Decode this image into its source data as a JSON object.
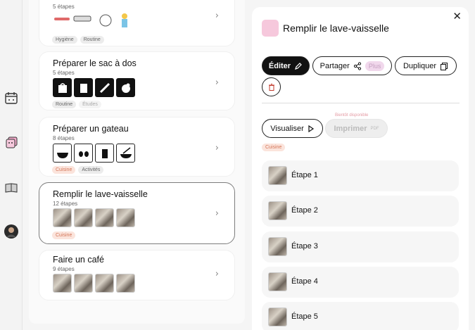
{
  "list": {
    "cards": [
      {
        "title": "",
        "steps": "5 étapes",
        "tags": [
          "Hygiène",
          "Routine"
        ]
      },
      {
        "title": "Préparer le sac à dos",
        "steps": "5 étapes",
        "tags": [
          "Routine",
          "Études"
        ]
      },
      {
        "title": "Préparer un gateau",
        "steps": "8 étapes",
        "tags": [
          "Cuisine",
          "Activités"
        ]
      },
      {
        "title": "Remplir le lave-vaisselle",
        "steps": "12 étapes",
        "tags": [
          "Cuisine"
        ]
      },
      {
        "title": "Faire un café",
        "steps": "9 étapes",
        "tags": []
      }
    ]
  },
  "detail": {
    "title": "Remplir le lave-vaisselle",
    "edit_label": "Éditer",
    "share_label": "Partager",
    "plus_badge": "Plus",
    "duplicate_label": "Dupliquer",
    "visualize_label": "Visualiser",
    "print_label": "Imprimer",
    "print_format": "PDF",
    "coming_soon": "Bientôt disponible",
    "tag": "Cuisine",
    "steps": [
      "Étape 1",
      "Étape 2",
      "Étape 3",
      "Étape 4",
      "Étape 5"
    ]
  },
  "colors": {
    "accent_pink": "#f6c8dc",
    "tag_cuisine": "#fbe4dc",
    "primary_dark": "#111111"
  }
}
